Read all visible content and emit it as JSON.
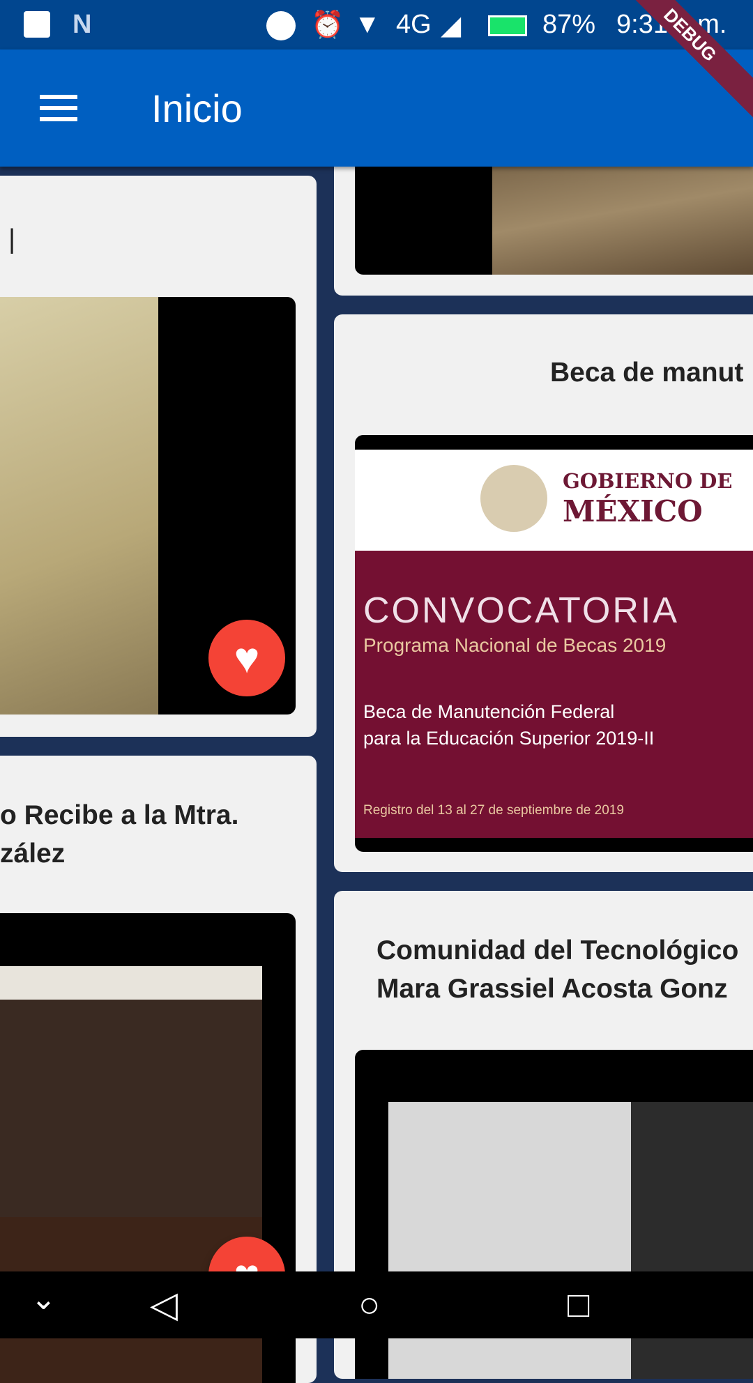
{
  "status_bar": {
    "battery": "87%",
    "time": "9:31 a.m.",
    "network": "4G",
    "icons": [
      "image-icon",
      "n-icon",
      "dnd-icon",
      "alarm-icon",
      "wifi-icon",
      "signal-icon",
      "battery-charging-icon"
    ]
  },
  "app_bar": {
    "title": "Inicio",
    "menu_icon": "hamburger-icon"
  },
  "debug_banner": "DEBUG",
  "colors": {
    "app_bar": "#005fc1",
    "status_bar": "#01468f",
    "background": "#1c3158",
    "card": "#f1f1f1",
    "favorite": "#f44336"
  },
  "cards": [
    {
      "title": "|"
    },
    {
      "title_lines": [
        "o Recibe a la Mtra.",
        "zález"
      ]
    },
    {
      "title": "Beca de manut",
      "image": {
        "brand": "GOBIERNO DE",
        "country": "MÉXICO",
        "heading": "CONVOCATORIA",
        "program": "Programa Nacional de Becas 2019",
        "line1": "Beca de Manutención Federal",
        "line2": "para la Educación Superior 2019-II",
        "registro": "Registro del 13 al 27 de septiembre de 2019"
      }
    },
    {
      "title_lines": [
        "Comunidad del Tecnológico",
        "Mara Grassiel Acosta Gonz"
      ]
    }
  ],
  "nav_bar": {
    "icons": [
      "chevron-down-icon",
      "back-icon",
      "home-icon",
      "recents-icon"
    ]
  }
}
